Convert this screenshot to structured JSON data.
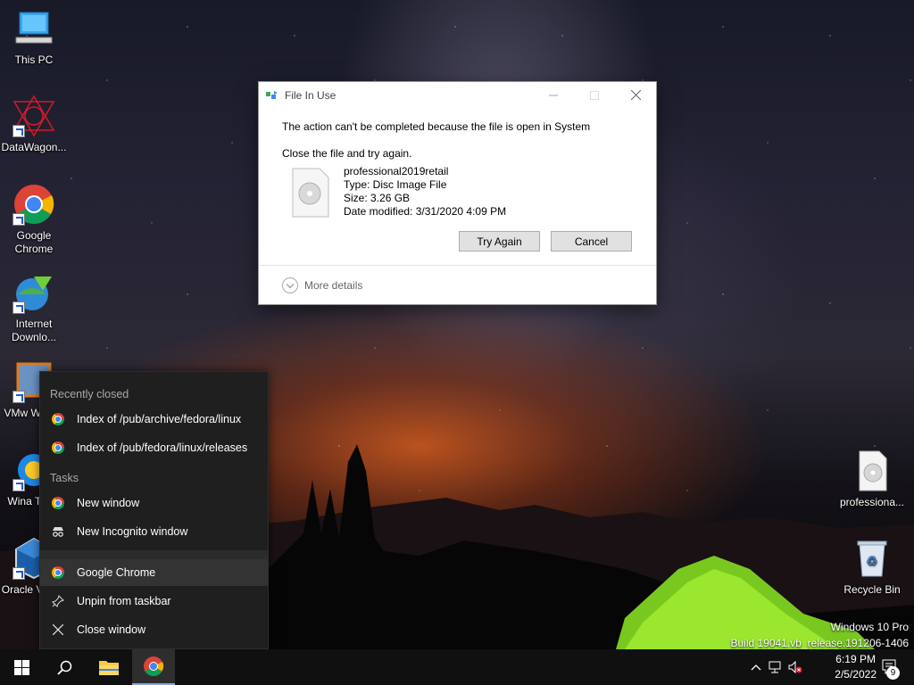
{
  "desktop": {
    "icons": [
      {
        "label": "This PC",
        "icon": "computer-icon"
      },
      {
        "label": "DataWagon...",
        "icon": "datawagon-icon"
      },
      {
        "label": "Google Chrome",
        "icon": "chrome-icon"
      },
      {
        "label": "Internet Downlo...",
        "icon": "idm-icon"
      },
      {
        "label": "VMw Workst",
        "icon": "vmware-icon"
      },
      {
        "label": "Wina Twea",
        "icon": "winaero-icon"
      },
      {
        "label": "Oracle Virtual",
        "icon": "virtualbox-icon"
      },
      {
        "label": "professiona...",
        "icon": "disc-image-icon"
      },
      {
        "label": "Recycle Bin",
        "icon": "recycle-bin-icon"
      }
    ],
    "watermark": {
      "line1": "Windows 10 Pro",
      "line2": "Build 19041.vb_release.191206-1406"
    }
  },
  "dialog": {
    "title": "File In Use",
    "message": "The action can't be completed because the file is open in System",
    "instruction": "Close the file and try again.",
    "file": {
      "name": "professional2019retail",
      "type": "Type: Disc Image File",
      "size": "Size: 3.26 GB",
      "modified": "Date modified: 3/31/2020 4:09 PM"
    },
    "try_again_label": "Try Again",
    "cancel_label": "Cancel",
    "more_details_label": "More details"
  },
  "jumplist": {
    "recent_header": "Recently closed",
    "recent": [
      "Index of /pub/archive/fedora/linux",
      "Index of /pub/fedora/linux/releases"
    ],
    "tasks_header": "Tasks",
    "tasks": [
      "New window",
      "New Incognito window"
    ],
    "app_name": "Google Chrome",
    "unpin_label": "Unpin from taskbar",
    "close_label": "Close window"
  },
  "taskbar": {
    "time": "6:19 PM",
    "date": "2/5/2022",
    "notification_count": "9"
  },
  "colors": {
    "taskbar_bg": "#101010",
    "jumplist_bg": "#1f1f1f",
    "accent": "#7aa9e8"
  }
}
